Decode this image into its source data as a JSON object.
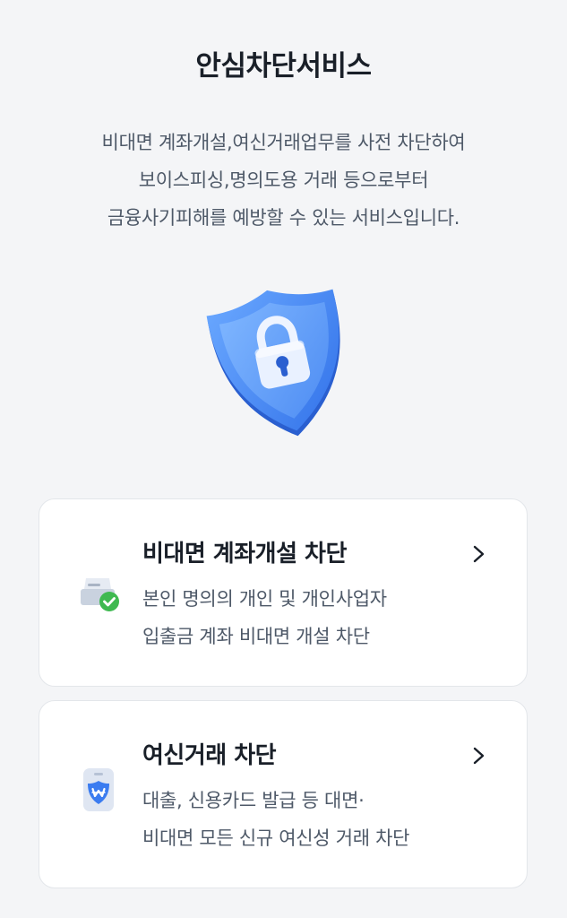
{
  "page": {
    "title": "안심차단서비스",
    "description": [
      "비대면 계좌개설,여신거래업무를 사전 차단하여",
      "보이스피싱,명의도용 거래 등으로부터",
      "금융사기피해를 예방할 수 있는 서비스입니다."
    ],
    "hero_icon": "shield-lock-icon"
  },
  "cards": [
    {
      "title": "비대면 계좌개설 차단",
      "lines": [
        "본인 명의의 개인 및 개인사업자",
        "입출금 계좌 비대면 개설 차단"
      ],
      "icon": "bankbook-check-icon"
    },
    {
      "title": "여신거래 차단",
      "lines": [
        "대출, 신용카드 발급 등 대면·",
        "비대면 모든 신규 여신성 거래 차단"
      ],
      "icon": "card-won-shield-icon"
    }
  ],
  "colors": {
    "background": "#f4f5f7",
    "card": "#ffffff",
    "accent_blue": "#3b7cf0",
    "check_green": "#3fb950"
  }
}
